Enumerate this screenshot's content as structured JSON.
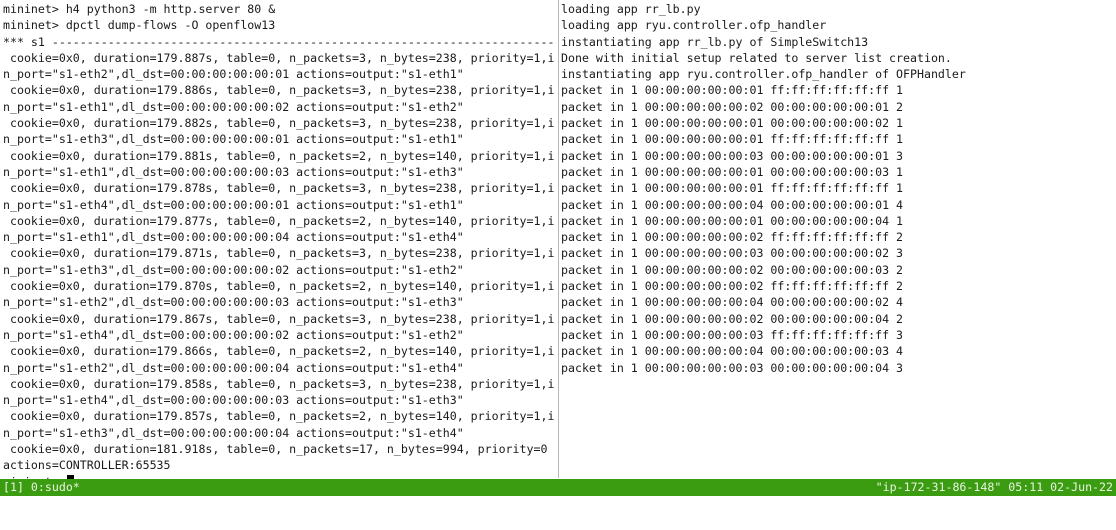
{
  "left_pane": {
    "lines": [
      "mininet> h4 python3 -m http.server 80 &",
      "mininet> dpctl dump-flows -O openflow13",
      "*** s1 ------------------------------------------------------------------------",
      " cookie=0x0, duration=179.887s, table=0, n_packets=3, n_bytes=238, priority=1,i",
      "n_port=\"s1-eth2\",dl_dst=00:00:00:00:00:01 actions=output:\"s1-eth1\"",
      " cookie=0x0, duration=179.886s, table=0, n_packets=3, n_bytes=238, priority=1,i",
      "n_port=\"s1-eth1\",dl_dst=00:00:00:00:00:02 actions=output:\"s1-eth2\"",
      " cookie=0x0, duration=179.882s, table=0, n_packets=3, n_bytes=238, priority=1,i",
      "n_port=\"s1-eth3\",dl_dst=00:00:00:00:00:01 actions=output:\"s1-eth1\"",
      " cookie=0x0, duration=179.881s, table=0, n_packets=2, n_bytes=140, priority=1,i",
      "n_port=\"s1-eth1\",dl_dst=00:00:00:00:00:03 actions=output:\"s1-eth3\"",
      " cookie=0x0, duration=179.878s, table=0, n_packets=3, n_bytes=238, priority=1,i",
      "n_port=\"s1-eth4\",dl_dst=00:00:00:00:00:01 actions=output:\"s1-eth1\"",
      " cookie=0x0, duration=179.877s, table=0, n_packets=2, n_bytes=140, priority=1,i",
      "n_port=\"s1-eth1\",dl_dst=00:00:00:00:00:04 actions=output:\"s1-eth4\"",
      " cookie=0x0, duration=179.871s, table=0, n_packets=3, n_bytes=238, priority=1,i",
      "n_port=\"s1-eth3\",dl_dst=00:00:00:00:00:02 actions=output:\"s1-eth2\"",
      " cookie=0x0, duration=179.870s, table=0, n_packets=2, n_bytes=140, priority=1,i",
      "n_port=\"s1-eth2\",dl_dst=00:00:00:00:00:03 actions=output:\"s1-eth3\"",
      " cookie=0x0, duration=179.867s, table=0, n_packets=3, n_bytes=238, priority=1,i",
      "n_port=\"s1-eth4\",dl_dst=00:00:00:00:00:02 actions=output:\"s1-eth2\"",
      " cookie=0x0, duration=179.866s, table=0, n_packets=2, n_bytes=140, priority=1,i",
      "n_port=\"s1-eth2\",dl_dst=00:00:00:00:00:04 actions=output:\"s1-eth4\"",
      " cookie=0x0, duration=179.858s, table=0, n_packets=3, n_bytes=238, priority=1,i",
      "n_port=\"s1-eth4\",dl_dst=00:00:00:00:00:03 actions=output:\"s1-eth3\"",
      " cookie=0x0, duration=179.857s, table=0, n_packets=2, n_bytes=140, priority=1,i",
      "n_port=\"s1-eth3\",dl_dst=00:00:00:00:00:04 actions=output:\"s1-eth4\"",
      " cookie=0x0, duration=181.918s, table=0, n_packets=17, n_bytes=994, priority=0",
      "actions=CONTROLLER:65535"
    ],
    "prompt": "mininet> "
  },
  "right_pane": {
    "lines": [
      "loading app rr_lb.py",
      "loading app ryu.controller.ofp_handler",
      "instantiating app rr_lb.py of SimpleSwitch13",
      "Done with initial setup related to server list creation.",
      "instantiating app ryu.controller.ofp_handler of OFPHandler",
      "packet in 1 00:00:00:00:00:01 ff:ff:ff:ff:ff:ff 1",
      "packet in 1 00:00:00:00:00:02 00:00:00:00:00:01 2",
      "packet in 1 00:00:00:00:00:01 00:00:00:00:00:02 1",
      "packet in 1 00:00:00:00:00:01 ff:ff:ff:ff:ff:ff 1",
      "packet in 1 00:00:00:00:00:03 00:00:00:00:00:01 3",
      "packet in 1 00:00:00:00:00:01 00:00:00:00:00:03 1",
      "packet in 1 00:00:00:00:00:01 ff:ff:ff:ff:ff:ff 1",
      "packet in 1 00:00:00:00:00:04 00:00:00:00:00:01 4",
      "packet in 1 00:00:00:00:00:01 00:00:00:00:00:04 1",
      "packet in 1 00:00:00:00:00:02 ff:ff:ff:ff:ff:ff 2",
      "packet in 1 00:00:00:00:00:03 00:00:00:00:00:02 3",
      "packet in 1 00:00:00:00:00:02 00:00:00:00:00:03 2",
      "packet in 1 00:00:00:00:00:02 ff:ff:ff:ff:ff:ff 2",
      "packet in 1 00:00:00:00:00:04 00:00:00:00:00:02 4",
      "packet in 1 00:00:00:00:00:02 00:00:00:00:00:04 2",
      "packet in 1 00:00:00:00:00:03 ff:ff:ff:ff:ff:ff 3",
      "packet in 1 00:00:00:00:00:04 00:00:00:00:00:03 4",
      "packet in 1 00:00:00:00:00:03 00:00:00:00:00:04 3"
    ]
  },
  "status_bar": {
    "left": "[1] 0:sudo*",
    "right": "\"ip-172-31-86-148\" 05:11 02-Jun-22"
  },
  "colors": {
    "status_bar_bg": "#3b9c12",
    "terminal_bg": "#ffffff",
    "terminal_fg": "#1a1a1a"
  },
  "icons": {
    "cursor": "block-cursor-icon"
  }
}
